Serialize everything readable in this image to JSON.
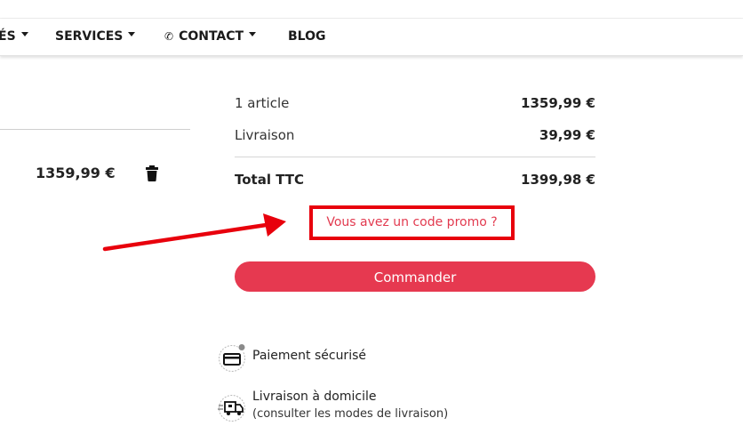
{
  "nav": {
    "items": [
      {
        "label": "ÉS"
      },
      {
        "label": "SERVICES"
      },
      {
        "label": "CONTACT"
      },
      {
        "label": "BLOG"
      }
    ]
  },
  "cart": {
    "item_price": "1359,99 €"
  },
  "summary": {
    "articles_label": "1 article",
    "articles_value": "1359,99 €",
    "shipping_label": "Livraison",
    "shipping_value": "39,99 €",
    "total_label": "Total TTC",
    "total_value": "1399,98 €"
  },
  "promo": {
    "link_text": "Vous avez un code promo ?"
  },
  "checkout": {
    "button_label": "Commander"
  },
  "reassurance": {
    "payment_label": "Paiement sécurisé",
    "delivery_label": "Livraison à domicile",
    "delivery_sub": "(consulter les modes de livraison)"
  },
  "colors": {
    "accent": "#e63950",
    "annotation_red": "#e8000c"
  },
  "icons": [
    "caret-down-icon",
    "phone-icon",
    "trash-icon",
    "card-icon",
    "delivery-truck-icon"
  ]
}
